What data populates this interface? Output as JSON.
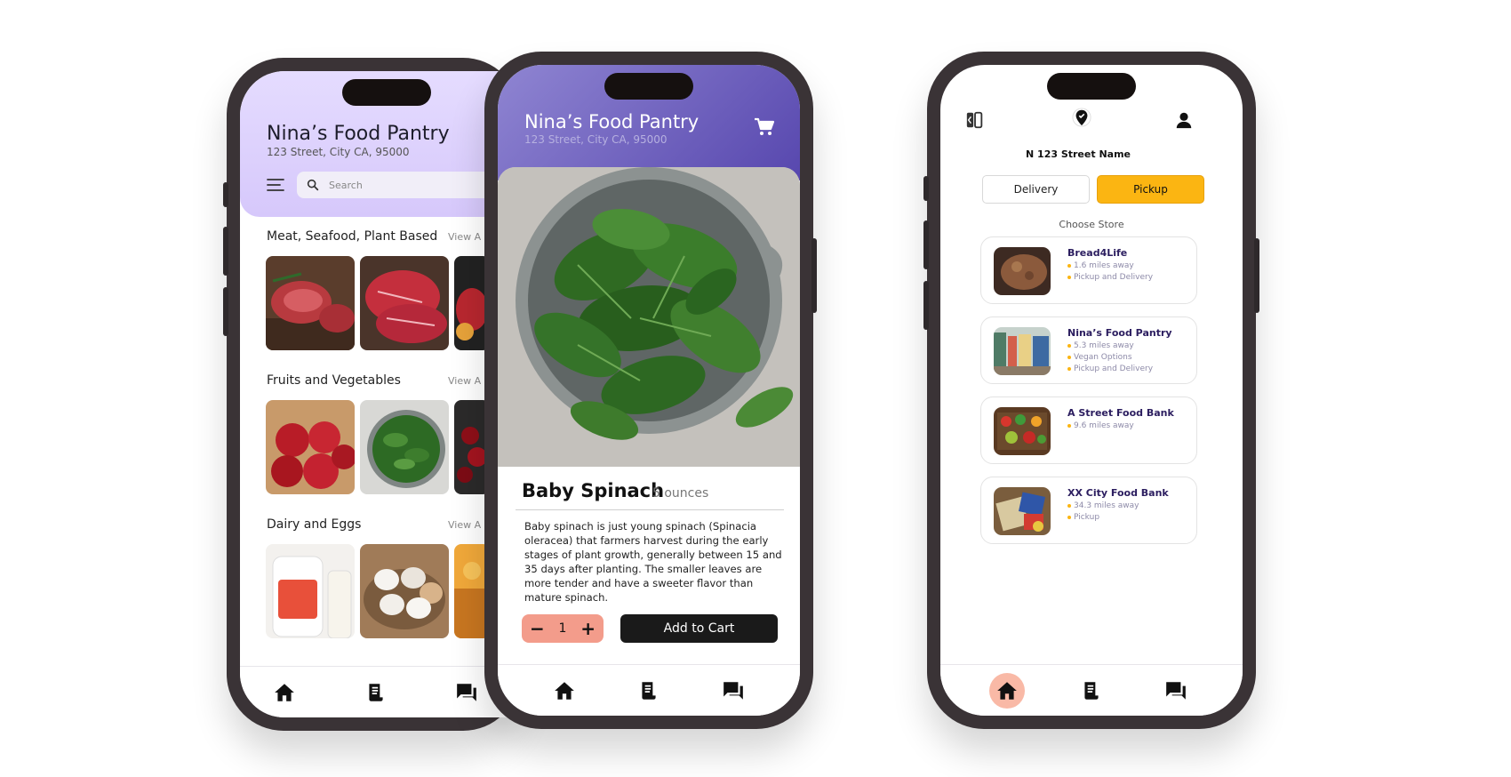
{
  "phone1": {
    "header": {
      "title": "Nina’s Food Pantry",
      "address": "123 Street, City CA, 95000",
      "search_placeholder": "Search"
    },
    "sections": [
      {
        "title": "Meat, Seafood, Plant Based",
        "view_all": "View A"
      },
      {
        "title": "Fruits and Vegetables",
        "view_all": "View A"
      },
      {
        "title": "Dairy and Eggs",
        "view_all": "View A"
      }
    ],
    "nav": [
      "home-icon",
      "document-icon",
      "chat-icon"
    ]
  },
  "phone2": {
    "header": {
      "title": "Nina’s Food Pantry",
      "address": "123 Street, City CA, 95000"
    },
    "product": {
      "name": "Baby Spinach",
      "size": "5 ounces",
      "description": "Baby spinach is just young spinach (Spinacia oleracea) that farmers harvest during the early stages of plant growth, generally between 15 and 35 days after planting. The smaller leaves are more tender and have a sweeter flavor than mature spinach."
    },
    "stepper": {
      "minus": "−",
      "quantity": "1",
      "plus": "+"
    },
    "add_to_cart": "Add to Cart"
  },
  "phone3": {
    "street_name": "N 123 Street Name",
    "toggle": {
      "delivery": "Delivery",
      "pickup": "Pickup",
      "selected": "Pickup"
    },
    "choose_label": "Choose Store",
    "stores": [
      {
        "name": "Bread4Life",
        "details": [
          "1.6 miles away",
          "Pickup and Delivery"
        ]
      },
      {
        "name": "Nina’s Food Pantry",
        "details": [
          "5.3 miles away",
          "Vegan Options",
          "Pickup and Delivery"
        ]
      },
      {
        "name": "A Street Food Bank",
        "details": [
          "9.6 miles away"
        ]
      },
      {
        "name": "XX City Food Bank",
        "details": [
          "34.3 miles away",
          "Pickup"
        ]
      }
    ]
  },
  "colors": {
    "pickup_accent": "#fbb512",
    "stepper": "#f39c8b",
    "header_purple": "#5747ae",
    "header_lavender": "#d6c8fb",
    "active_nav": "#f9b9a6"
  }
}
